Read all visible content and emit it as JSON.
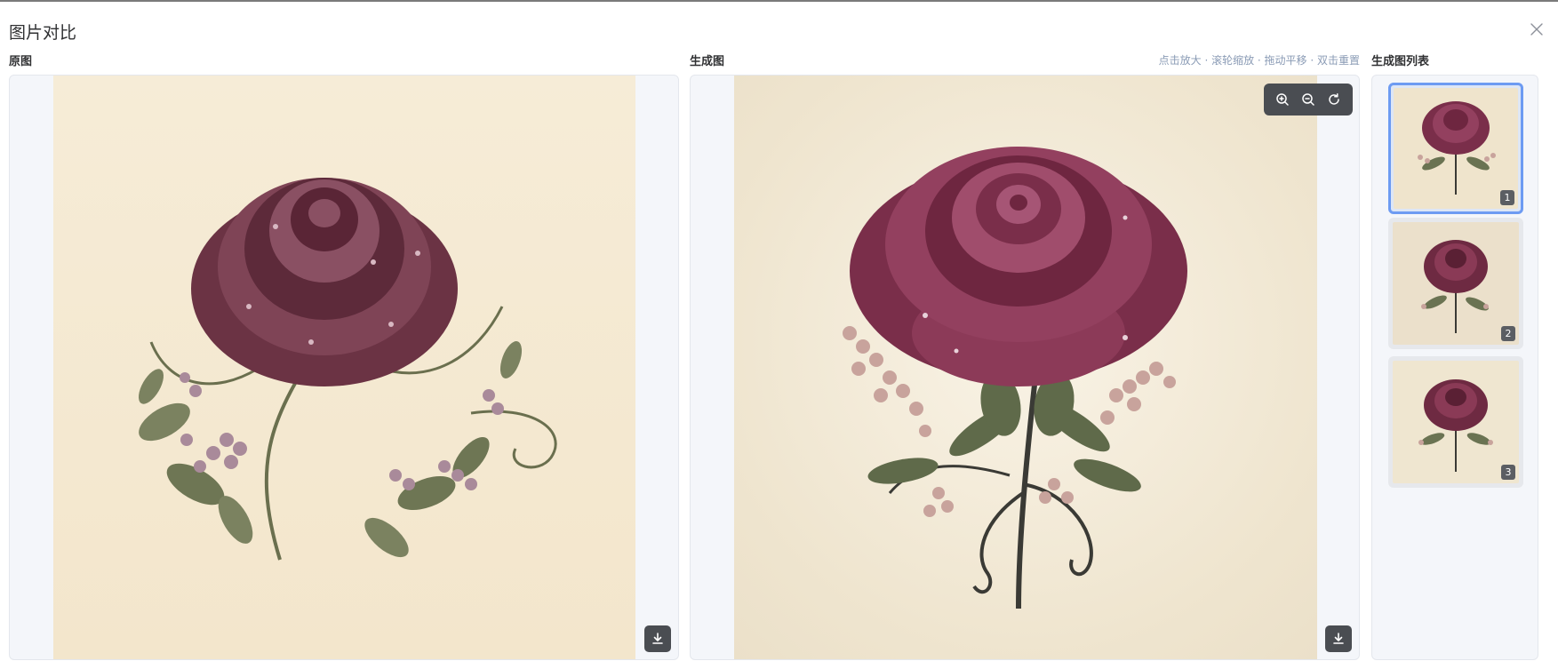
{
  "dialog": {
    "title": "图片对比",
    "close_icon": "close-icon"
  },
  "original": {
    "label": "原图",
    "download_icon": "download-icon"
  },
  "generated": {
    "label": "生成图",
    "hint": "点击放大 · 滚轮缩放 · 拖动平移 · 双击重置",
    "zoom_in_icon": "zoom-in-icon",
    "zoom_out_icon": "zoom-out-icon",
    "reset_icon": "reset-icon",
    "download_icon": "download-icon"
  },
  "list": {
    "label": "生成图列表",
    "items": [
      {
        "index": "1",
        "selected": true
      },
      {
        "index": "2",
        "selected": false
      },
      {
        "index": "3",
        "selected": false
      }
    ]
  },
  "colors": {
    "accent": "#6d9bf2",
    "rose_dark": "#5a1f33",
    "rose_mid": "#8c3a58",
    "leaf": "#5f6a4a",
    "blossom": "#c8a39c"
  }
}
